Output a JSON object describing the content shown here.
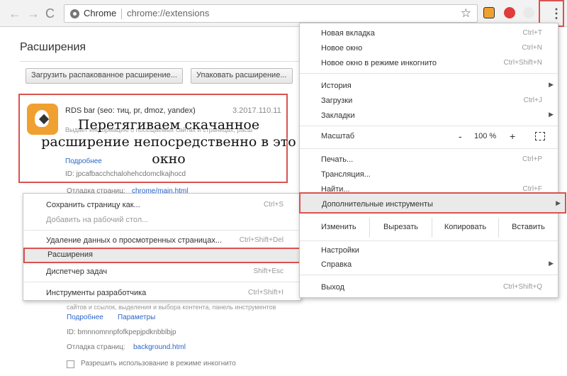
{
  "toolbar": {
    "back": "←",
    "forward": "→",
    "reload": "C",
    "omni_label": "Chrome",
    "url": "chrome://extensions",
    "star": "☆",
    "menu": "⋮"
  },
  "page": {
    "title": "Расширения",
    "btn_load": "Загрузить распакованное расширение...",
    "btn_pack": "Упаковать расширение..."
  },
  "extension": {
    "name": "RDS bar (seo: тиц, pr, dmoz, yandex)",
    "version": "3.2017.110.11",
    "desc": "Выдает информацию о посещаемых сайтах и страницах, расш",
    "details": "Подробнее",
    "id": "ID: jpcafbacchchalohehcdomclkajhocd",
    "debug_label": "Отладка страниц:",
    "debug_link": "chrome/main.html"
  },
  "overlay": "Перетягиваем скачанное расширение непосредственно в это окно",
  "extension2": {
    "desc": "сайтов и ссылок, выделения и выбора контента, панель инструментов",
    "details": "Подробнее",
    "params": "Параметры",
    "id": "ID: bmnnomnnpfofkpepjpdknbblbjp",
    "debug_label": "Отладка страниц:",
    "debug_link": "background.html",
    "incognito": "Разрешить использование в режиме инкогнито"
  },
  "submenu": {
    "save": "Сохранить страницу как...",
    "save_sc": "Ctrl+S",
    "desktop": "Добавить на рабочий стол...",
    "clear": "Удаление данных о просмотренных страницах...",
    "clear_sc": "Ctrl+Shift+Del",
    "extensions": "Расширения",
    "taskman": "Диспетчер задач",
    "taskman_sc": "Shift+Esc",
    "devtools": "Инструменты разработчика",
    "devtools_sc": "Ctrl+Shift+I"
  },
  "menu": {
    "new_tab": "Новая вкладка",
    "new_tab_sc": "Ctrl+T",
    "new_window": "Новое окно",
    "new_window_sc": "Ctrl+N",
    "incognito": "Новое окно в режиме инкогнито",
    "incognito_sc": "Ctrl+Shift+N",
    "history": "История",
    "downloads": "Загрузки",
    "downloads_sc": "Ctrl+J",
    "bookmarks": "Закладки",
    "zoom": "Масштаб",
    "zoom_minus": "-",
    "zoom_val": "100 %",
    "zoom_plus": "+",
    "print": "Печать...",
    "print_sc": "Ctrl+P",
    "cast": "Трансляция...",
    "find": "Найти...",
    "find_sc": "Ctrl+F",
    "more_tools": "Дополнительные инструменты",
    "edit": "Изменить",
    "cut": "Вырезать",
    "copy": "Копировать",
    "paste": "Вставить",
    "settings": "Настройки",
    "help": "Справка",
    "exit": "Выход",
    "exit_sc": "Ctrl+Shift+Q"
  },
  "colors": {
    "highlight": "#d9534f",
    "link": "#2a66c8"
  }
}
